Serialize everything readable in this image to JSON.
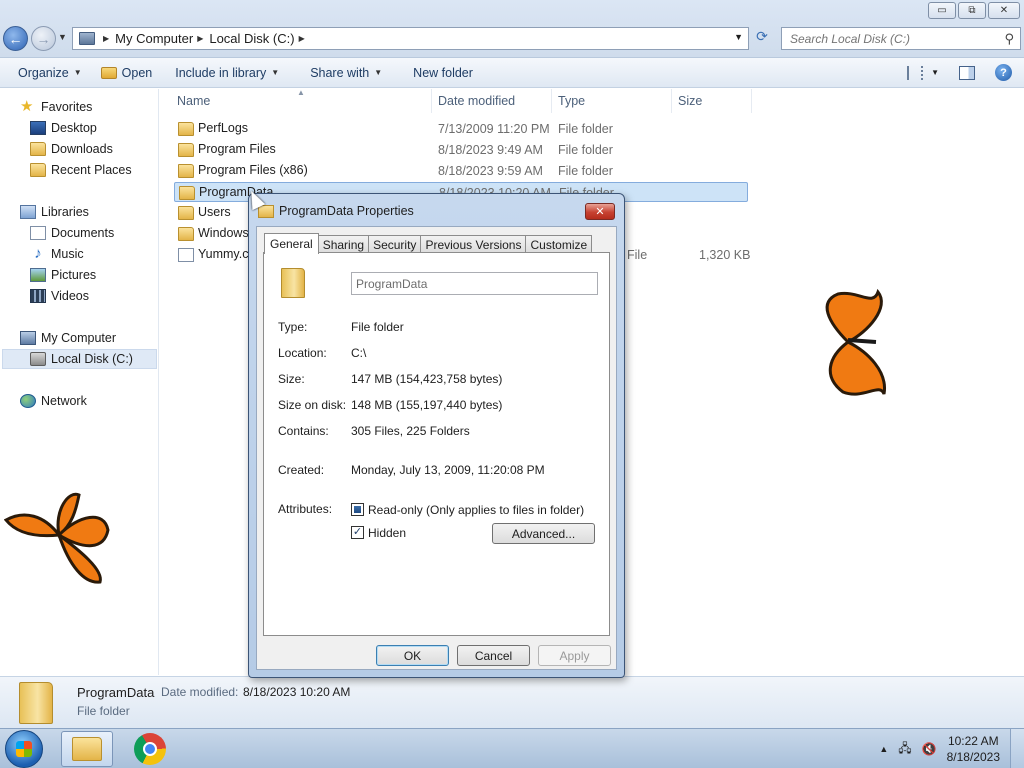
{
  "window": {
    "controls": {
      "minimize": "▭",
      "restore": "⧉",
      "close": "✕"
    }
  },
  "navigation": {
    "back": "←",
    "forward": "→",
    "breadcrumb": [
      "My Computer",
      "Local Disk (C:)"
    ],
    "search_placeholder": "Search Local Disk (C:)"
  },
  "toolbar": {
    "organize": "Organize",
    "open": "Open",
    "include_in_library": "Include in library",
    "share_with": "Share with",
    "new_folder": "New folder"
  },
  "sidebar": {
    "favorites": "Favorites",
    "desktop": "Desktop",
    "downloads": "Downloads",
    "recent_places": "Recent Places",
    "libraries": "Libraries",
    "documents": "Documents",
    "music": "Music",
    "pictures": "Pictures",
    "videos": "Videos",
    "my_computer": "My Computer",
    "local_disk": "Local Disk (C:)",
    "network": "Network"
  },
  "filelist": {
    "columns": {
      "name": "Name",
      "date_modified": "Date modified",
      "type": "Type",
      "size": "Size"
    },
    "rows": [
      {
        "name": "PerfLogs",
        "date": "7/13/2009 11:20 PM",
        "type": "File folder",
        "size": ""
      },
      {
        "name": "Program Files",
        "date": "8/18/2023 9:49 AM",
        "type": "File folder",
        "size": ""
      },
      {
        "name": "Program Files (x86)",
        "date": "8/18/2023 9:59 AM",
        "type": "File folder",
        "size": ""
      },
      {
        "name": "ProgramData",
        "date": "8/18/2023 10:20 AM",
        "type": "File folder",
        "size": ""
      },
      {
        "name": "Users",
        "date": "",
        "type": "",
        "size": ""
      },
      {
        "name": "Windows",
        "date": "",
        "type": "",
        "size": ""
      },
      {
        "name": "Yummy.c",
        "date": "",
        "type": "File",
        "size": "1,320 KB"
      }
    ]
  },
  "details": {
    "name": "ProgramData",
    "date_label": "Date modified:",
    "date_value": "8/18/2023 10:20 AM",
    "type": "File folder"
  },
  "dialog": {
    "title": "ProgramData Properties",
    "close": "✕",
    "tabs": [
      "General",
      "Sharing",
      "Security",
      "Previous Versions",
      "Customize"
    ],
    "folder_name": "ProgramData",
    "fields": {
      "type_label": "Type:",
      "type_value": "File folder",
      "location_label": "Location:",
      "location_value": "C:\\",
      "size_label": "Size:",
      "size_value": "147 MB (154,423,758 bytes)",
      "size_on_disk_label": "Size on disk:",
      "size_on_disk_value": "148 MB (155,197,440 bytes)",
      "contains_label": "Contains:",
      "contains_value": "305 Files, 225 Folders",
      "created_label": "Created:",
      "created_value": "Monday, July 13, 2009, 11:20:08 PM",
      "attributes_label": "Attributes:",
      "readonly_label": "Read-only (Only applies to files in folder)",
      "readonly_state": "indeterminate",
      "hidden_label": "Hidden",
      "hidden_state": "checked",
      "advanced": "Advanced..."
    },
    "buttons": {
      "ok": "OK",
      "cancel": "Cancel",
      "apply": "Apply"
    }
  },
  "taskbar": {
    "time": "10:22 AM",
    "date": "8/18/2023"
  }
}
